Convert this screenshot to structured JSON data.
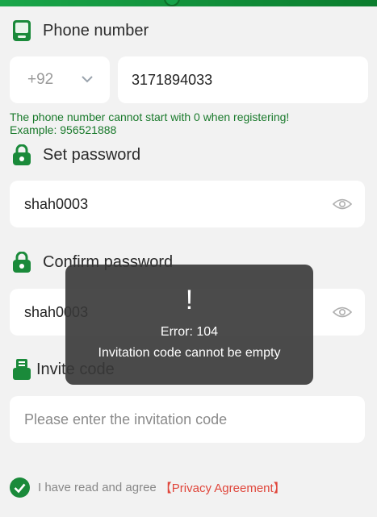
{
  "colors": {
    "accent": "#1a8a3a",
    "hint": "#1a7a2c",
    "link": "#e0463b",
    "toast_bg": "#373737"
  },
  "phone": {
    "label": "Phone number",
    "label_icon": "phone-icon",
    "country_code": "+92",
    "value": "3171894033",
    "hint_line1": "The phone number cannot start with 0 when registering!",
    "hint_line2": "Example: 956521888"
  },
  "password": {
    "label": "Set password",
    "label_icon": "lock-icon",
    "value": "shah0003",
    "toggle_icon": "eye-icon"
  },
  "confirm_password": {
    "label": "Confirm password",
    "label_icon": "lock-icon",
    "value": "shah0003",
    "toggle_icon": "eye-icon"
  },
  "invite": {
    "label": "Invite code",
    "label_icon": "ticket-icon",
    "placeholder": "Please enter the invitation code",
    "value": ""
  },
  "agreement": {
    "text": "I have read and agree",
    "link": "【Privacy Agreement】",
    "checked": true
  },
  "toast": {
    "icon": "!",
    "title": "Error: 104",
    "message": "Invitation code cannot be empty"
  }
}
